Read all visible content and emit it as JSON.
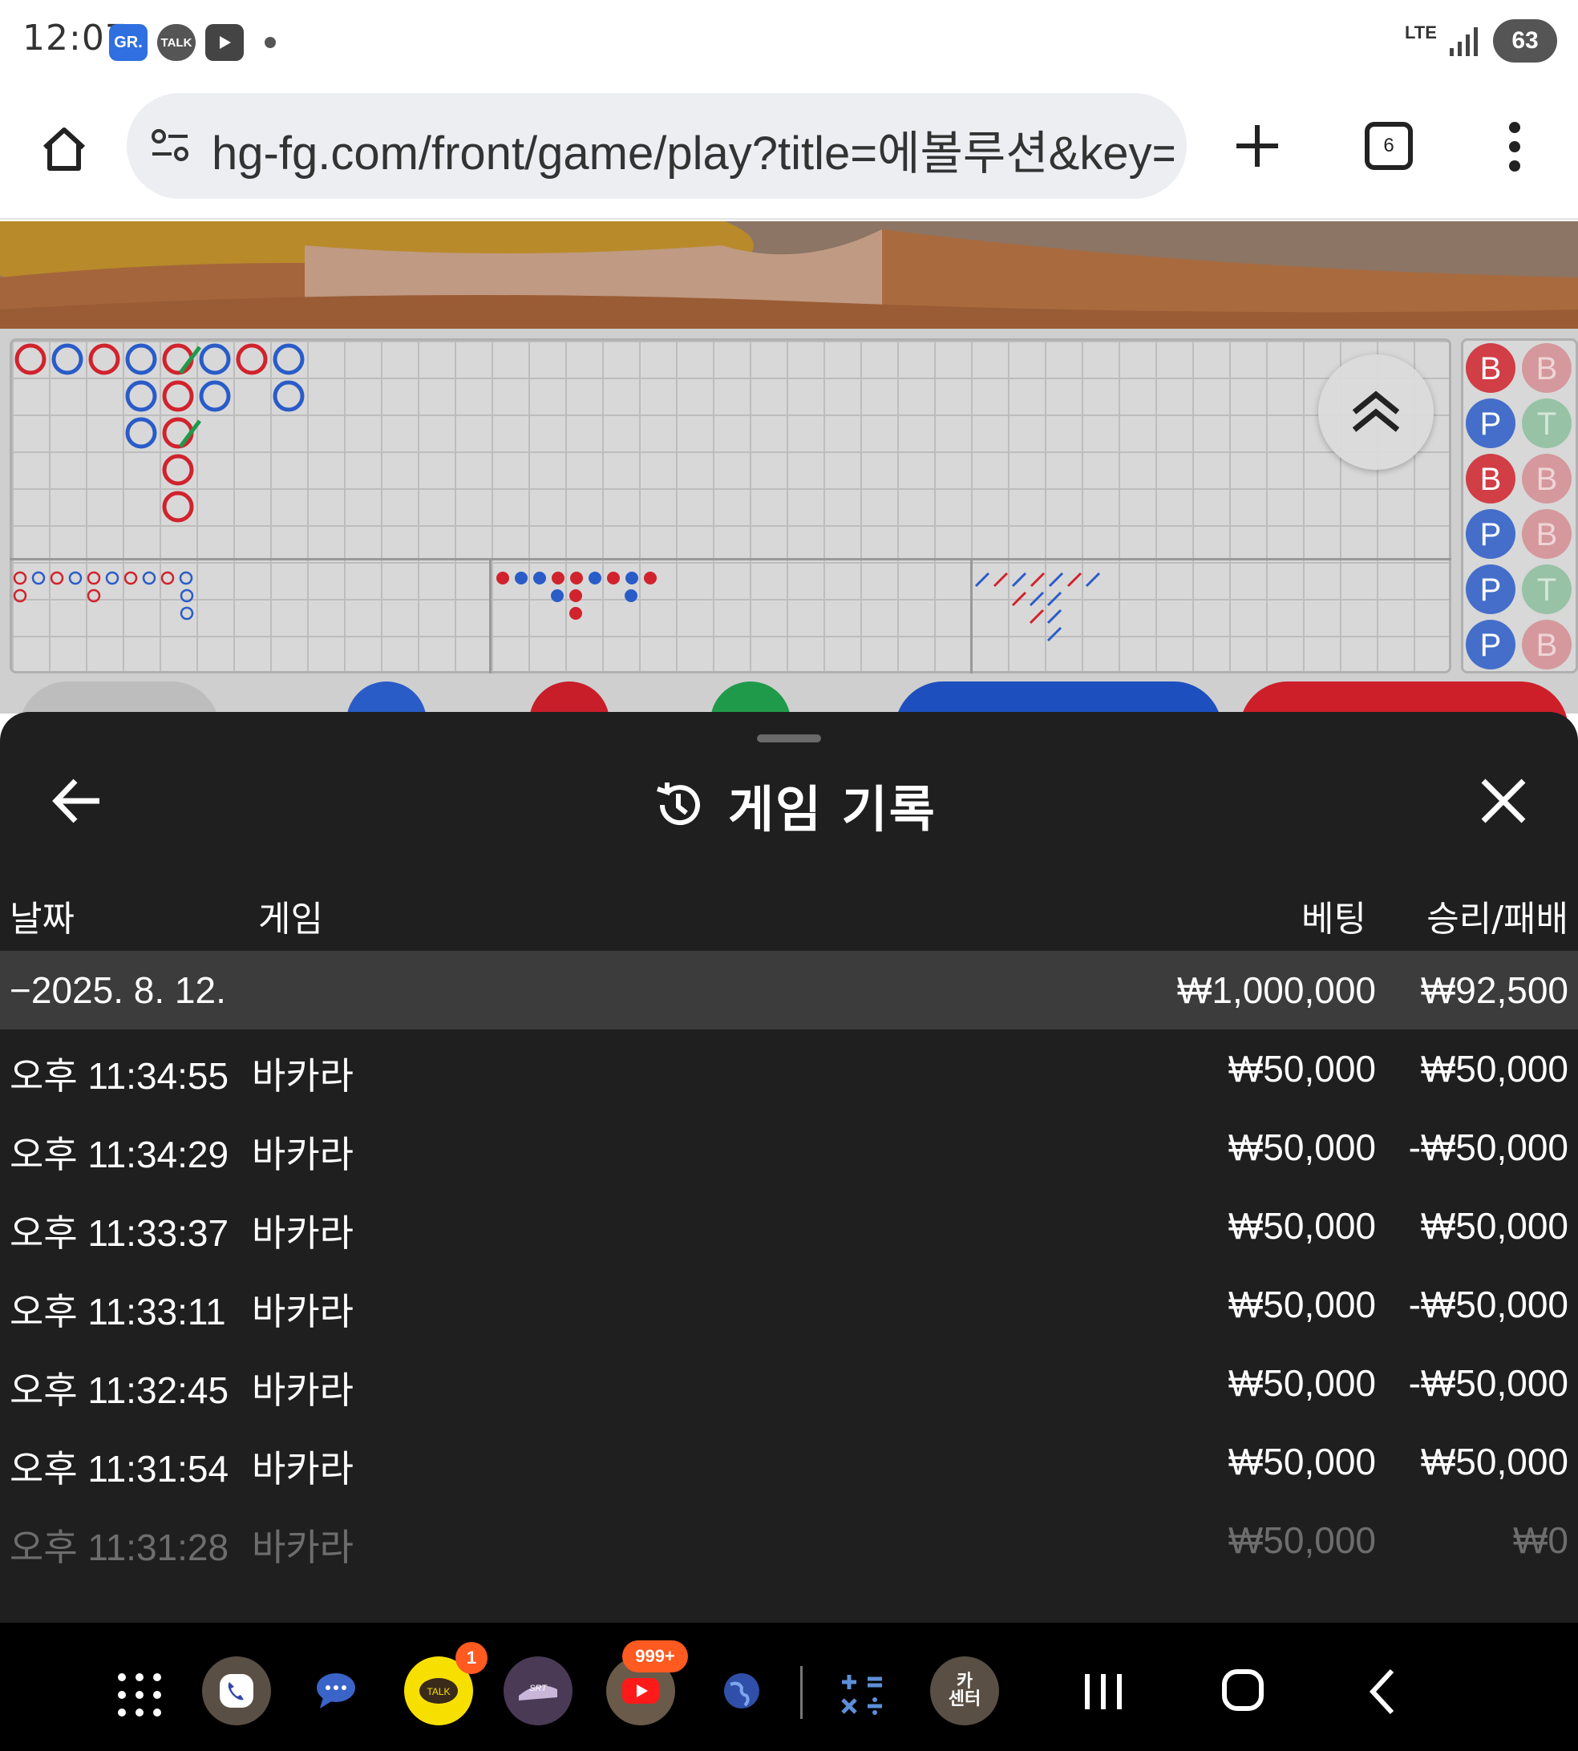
{
  "status_bar": {
    "time": "12:07",
    "notification_icons": [
      "gr-app-icon",
      "kakaotalk-icon",
      "youtube-icon",
      "dot-icon"
    ],
    "gr_label": "GR.",
    "talk_label": "TALK",
    "network": "LTE",
    "battery": "63"
  },
  "browser": {
    "url": "hg-fg.com/front/game/play?title=에볼루션&key=",
    "tab_count": "6"
  },
  "roadmap": {
    "predict_labels": [
      "B",
      "B",
      "P",
      "T",
      "B",
      "B",
      "P",
      "B",
      "P",
      "T",
      "P",
      "B"
    ]
  },
  "sheet": {
    "title": "게임 기록",
    "columns": {
      "date": "날짜",
      "game": "게임",
      "bet": "베팅",
      "result": "승리/패배"
    },
    "date_group": {
      "date": "−2025. 8. 12.",
      "bet_total": "₩1,000,000",
      "result_total": "₩92,500"
    },
    "records": [
      {
        "time": "오후 11:34:55",
        "game": "바카라",
        "bet": "₩50,000",
        "result": "₩50,000"
      },
      {
        "time": "오후 11:34:29",
        "game": "바카라",
        "bet": "₩50,000",
        "result": "-₩50,000"
      },
      {
        "time": "오후 11:33:37",
        "game": "바카라",
        "bet": "₩50,000",
        "result": "₩50,000"
      },
      {
        "time": "오후 11:33:11",
        "game": "바카라",
        "bet": "₩50,000",
        "result": "-₩50,000"
      },
      {
        "time": "오후 11:32:45",
        "game": "바카라",
        "bet": "₩50,000",
        "result": "-₩50,000"
      },
      {
        "time": "오후 11:31:54",
        "game": "바카라",
        "bet": "₩50,000",
        "result": "₩50,000"
      },
      {
        "time": "오후 11:31:28",
        "game": "바카라",
        "bet": "₩50,000",
        "result": "₩0"
      }
    ]
  },
  "nav_bar": {
    "badge_talk": "1",
    "badge_youtube": "999+",
    "casino_center_label_1": "카",
    "casino_center_label_2": "센터"
  },
  "colors": {
    "banker": "#d0232d",
    "player": "#2a5cc8",
    "tie": "#1f9a4a",
    "sheet_bg": "#1f1f1f",
    "group_row_bg": "#3c3c3c"
  }
}
